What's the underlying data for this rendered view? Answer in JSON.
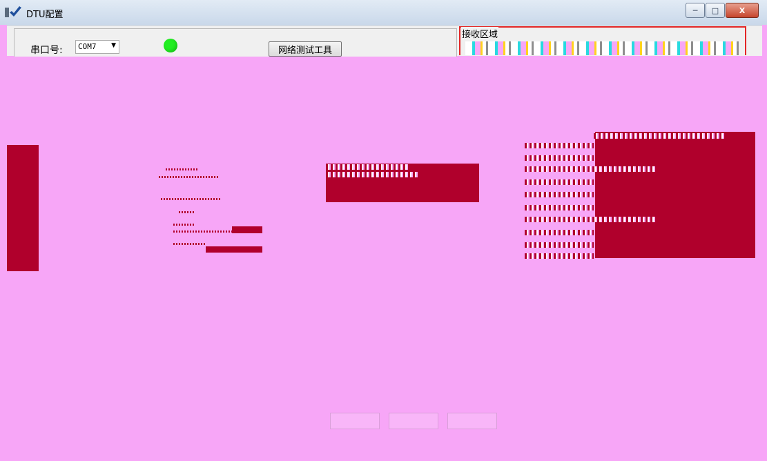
{
  "window": {
    "title": "DTU配置",
    "minimize_glyph": "─",
    "maximize_glyph": "□",
    "close_glyph": "X"
  },
  "serial": {
    "label": "串口号:",
    "port_value": "COM7",
    "dropdown_glyph": "▼",
    "status_color": "#22ee22"
  },
  "toolbar": {
    "network_test_label": "网络测试工具"
  },
  "receive": {
    "label": "接收区域",
    "border_color": "#e32626"
  },
  "colors": {
    "background_mask": "#f7a6f7",
    "redaction_block": "#b0002c"
  }
}
